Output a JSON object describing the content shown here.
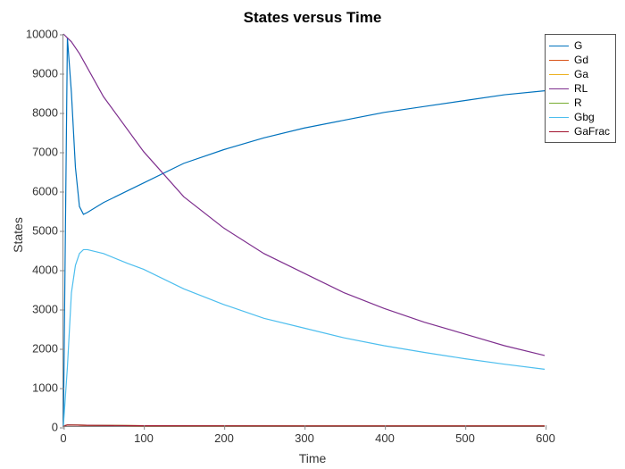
{
  "chart_data": {
    "type": "line",
    "title": "States versus Time",
    "xlabel": "Time",
    "ylabel": "States",
    "xlim": [
      0,
      600
    ],
    "ylim": [
      0,
      10000
    ],
    "xticks": [
      0,
      100,
      200,
      300,
      400,
      500,
      600
    ],
    "yticks": [
      0,
      1000,
      2000,
      3000,
      4000,
      5000,
      6000,
      7000,
      8000,
      9000,
      10000
    ],
    "series": [
      {
        "name": "G",
        "color": "#0072BD",
        "x": [
          0,
          5,
          10,
          15,
          20,
          25,
          30,
          50,
          80,
          100,
          150,
          200,
          250,
          300,
          350,
          400,
          450,
          500,
          550,
          600
        ],
        "y": [
          0,
          9900,
          8500,
          6600,
          5600,
          5400,
          5450,
          5700,
          6000,
          6200,
          6700,
          7050,
          7350,
          7600,
          7800,
          8000,
          8150,
          8300,
          8450,
          8550
        ]
      },
      {
        "name": "Gd",
        "color": "#D95319",
        "x": [
          0,
          5,
          30,
          100,
          300,
          600
        ],
        "y": [
          0,
          30,
          20,
          10,
          5,
          5
        ]
      },
      {
        "name": "Ga",
        "color": "#EDB120",
        "x": [
          0,
          5,
          30,
          100,
          300,
          600
        ],
        "y": [
          0,
          30,
          20,
          10,
          5,
          5
        ]
      },
      {
        "name": "RL",
        "color": "#7E2F8E",
        "x": [
          0,
          5,
          10,
          20,
          50,
          100,
          150,
          200,
          250,
          300,
          350,
          400,
          450,
          500,
          550,
          600
        ],
        "y": [
          10000,
          9900,
          9800,
          9500,
          8400,
          7000,
          5850,
          5050,
          4400,
          3900,
          3400,
          3000,
          2650,
          2350,
          2050,
          1800
        ]
      },
      {
        "name": "R",
        "color": "#77AC30",
        "x": [
          0,
          5,
          30,
          100,
          300,
          600
        ],
        "y": [
          0,
          30,
          20,
          10,
          5,
          5
        ]
      },
      {
        "name": "Gbg",
        "color": "#4DBEEE",
        "x": [
          0,
          5,
          10,
          15,
          20,
          25,
          30,
          50,
          80,
          100,
          150,
          200,
          250,
          300,
          350,
          400,
          450,
          500,
          550,
          600
        ],
        "y": [
          0,
          1500,
          3400,
          4100,
          4400,
          4500,
          4500,
          4400,
          4150,
          4000,
          3500,
          3100,
          2750,
          2500,
          2250,
          2050,
          1880,
          1720,
          1580,
          1450
        ]
      },
      {
        "name": "GaFrac",
        "color": "#A2142F",
        "x": [
          0,
          5,
          30,
          100,
          300,
          600
        ],
        "y": [
          0,
          30,
          20,
          10,
          5,
          5
        ]
      }
    ]
  }
}
